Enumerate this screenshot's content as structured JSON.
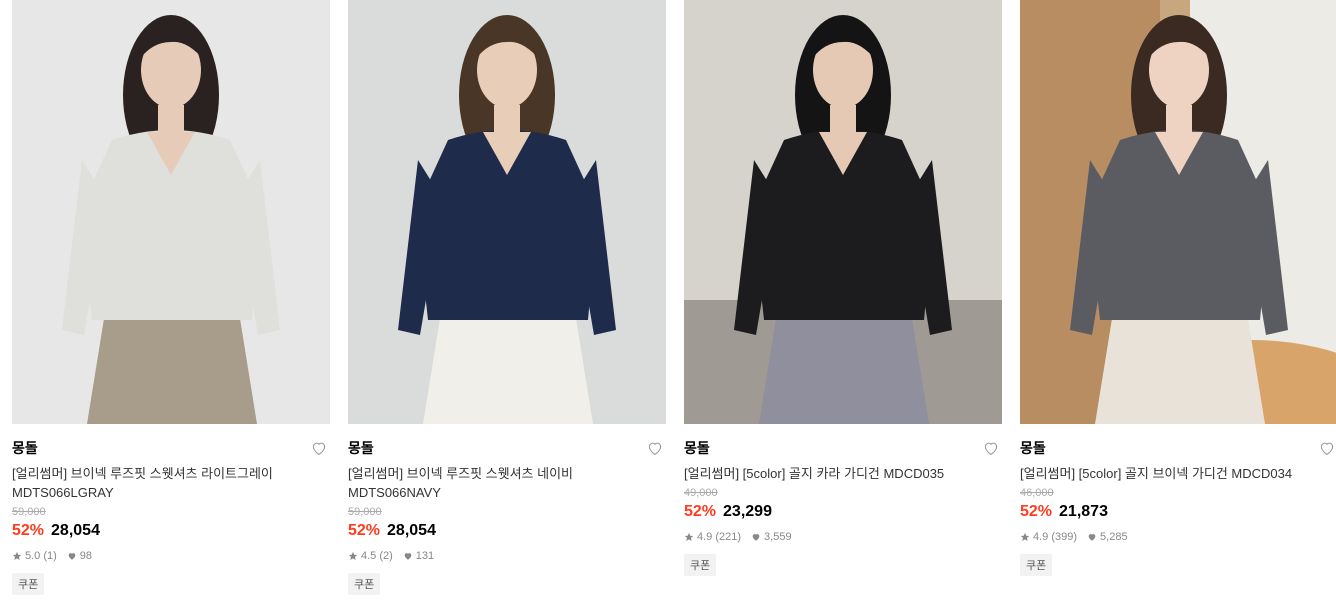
{
  "products": [
    {
      "brand": "몽돌",
      "title": "[얼리썸머] 브이넥 루즈핏 스웻셔츠 라이트그레이 MDTS066LGRAY",
      "original_price": "59,000",
      "discount": "52%",
      "price": "28,054",
      "rating": "5.0 (1)",
      "likes": "98",
      "coupon": "쿠폰",
      "image_alt": "woman in light gray v-neck sweatshirt and plaid skirt",
      "colors": {
        "bg": "#e6e7e6",
        "top": "#dfe0dc",
        "bottom": "#a89c8a",
        "hair": "#2a2221",
        "skin": "#e6cbb8"
      }
    },
    {
      "brand": "몽돌",
      "title": "[얼리썸머] 브이넥 루즈핏 스웻셔츠 네이비 MDTS066NAVY",
      "original_price": "59,000",
      "discount": "52%",
      "price": "28,054",
      "rating": "4.5 (2)",
      "likes": "131",
      "coupon": "쿠폰",
      "image_alt": "woman in navy v-neck sweatshirt and white ruffled shorts",
      "colors": {
        "bg": "#dadcdb",
        "top": "#1e2b4a",
        "bottom": "#f1efea",
        "hair": "#4a3626",
        "skin": "#e8cdb9"
      }
    },
    {
      "brand": "몽돌",
      "title": "[얼리썸머] [5color] 골지 카라 가디건 MDCD035",
      "original_price": "49,000",
      "discount": "52%",
      "price": "23,299",
      "rating": "4.9 (221)",
      "likes": "3,559",
      "coupon": "쿠폰",
      "image_alt": "woman in black ribbed cardigan holding a cup",
      "colors": {
        "bg": "#d6d3cd",
        "top": "#1c1c1f",
        "bottom": "#8f8f9e",
        "hair": "#141414",
        "skin": "#e5c9b5"
      }
    },
    {
      "brand": "몽돌",
      "title": "[얼리썸머] [5color] 골지 브이넥 가디건 MDCD034",
      "original_price": "46,000",
      "discount": "52%",
      "price": "21,873",
      "rating": "4.9 (399)",
      "likes": "5,285",
      "coupon": "쿠폰",
      "image_alt": "woman in gray ribbed v-neck cardigan at cafe table",
      "colors": {
        "bg": "#c9a77e",
        "top": "#5b5c62",
        "bottom": "#e8e2d8",
        "hair": "#3a2a22",
        "skin": "#efd3c2"
      }
    }
  ]
}
